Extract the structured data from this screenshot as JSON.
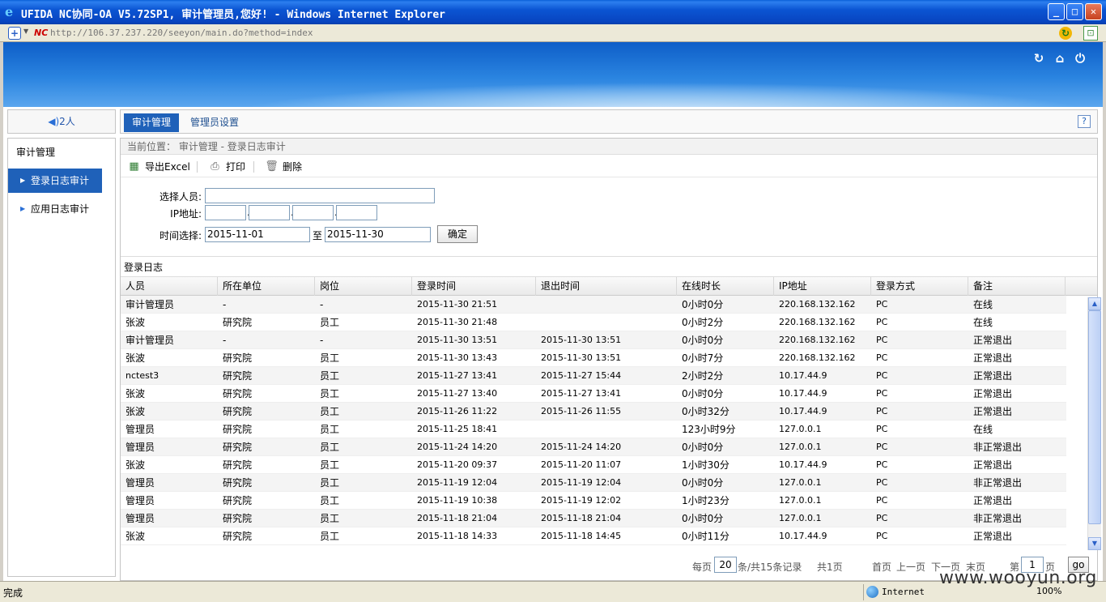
{
  "window": {
    "title": "UFIDA NC协同-OA V5.72SP1, 审计管理员,您好! - Windows Internet Explorer",
    "url": "http://106.37.237.220/seeyon/main.do?method=index",
    "nc_logo": "NC"
  },
  "header": {
    "icons": [
      "refresh-icon",
      "home-icon",
      "logout-icon"
    ]
  },
  "online": {
    "label": "2人"
  },
  "tabs": [
    {
      "label": "审计管理",
      "active": true
    },
    {
      "label": "管理员设置",
      "active": false
    }
  ],
  "help_label": "?",
  "sidebar": {
    "title": "审计管理",
    "items": [
      {
        "label": "登录日志审计",
        "active": true
      },
      {
        "label": "应用日志审计",
        "active": false
      }
    ]
  },
  "breadcrumb": "当前位置： 审计管理 - 登录日志审计",
  "toolbar": {
    "export_label": "导出Excel",
    "print_label": "打印",
    "delete_label": "删除"
  },
  "filters": {
    "person_label": "选择人员:",
    "person_value": "",
    "ip_label": "IP地址:",
    "ip_parts": [
      "",
      "",
      "",
      ""
    ],
    "time_label": "时间选择:",
    "time_from": "2015-11-01",
    "time_to_label": "至",
    "time_to": "2015-11-30",
    "confirm_label": "确定"
  },
  "section_title": "登录日志",
  "table": {
    "columns": [
      "人员",
      "所在单位",
      "岗位",
      "登录时间",
      "退出时间",
      "在线时长",
      "IP地址",
      "登录方式",
      "备注"
    ],
    "rows": [
      [
        "审计管理员",
        "-",
        "-",
        "2015-11-30 21:51",
        "",
        "0小时0分",
        "220.168.132.162",
        "PC",
        "在线"
      ],
      [
        "张波",
        "研究院",
        "员工",
        "2015-11-30 21:48",
        "",
        "0小时2分",
        "220.168.132.162",
        "PC",
        "在线"
      ],
      [
        "审计管理员",
        "-",
        "-",
        "2015-11-30 13:51",
        "2015-11-30 13:51",
        "0小时0分",
        "220.168.132.162",
        "PC",
        "正常退出"
      ],
      [
        "张波",
        "研究院",
        "员工",
        "2015-11-30 13:43",
        "2015-11-30 13:51",
        "0小时7分",
        "220.168.132.162",
        "PC",
        "正常退出"
      ],
      [
        "nctest3",
        "研究院",
        "员工",
        "2015-11-27 13:41",
        "2015-11-27 15:44",
        "2小时2分",
        "10.17.44.9",
        "PC",
        "正常退出"
      ],
      [
        "张波",
        "研究院",
        "员工",
        "2015-11-27 13:40",
        "2015-11-27 13:41",
        "0小时0分",
        "10.17.44.9",
        "PC",
        "正常退出"
      ],
      [
        "张波",
        "研究院",
        "员工",
        "2015-11-26 11:22",
        "2015-11-26 11:55",
        "0小时32分",
        "10.17.44.9",
        "PC",
        "正常退出"
      ],
      [
        "管理员",
        "研究院",
        "员工",
        "2015-11-25 18:41",
        "",
        "123小时9分",
        "127.0.0.1",
        "PC",
        "在线"
      ],
      [
        "管理员",
        "研究院",
        "员工",
        "2015-11-24 14:20",
        "2015-11-24 14:20",
        "0小时0分",
        "127.0.0.1",
        "PC",
        "非正常退出"
      ],
      [
        "张波",
        "研究院",
        "员工",
        "2015-11-20 09:37",
        "2015-11-20 11:07",
        "1小时30分",
        "10.17.44.9",
        "PC",
        "正常退出"
      ],
      [
        "管理员",
        "研究院",
        "员工",
        "2015-11-19 12:04",
        "2015-11-19 12:04",
        "0小时0分",
        "127.0.0.1",
        "PC",
        "非正常退出"
      ],
      [
        "管理员",
        "研究院",
        "员工",
        "2015-11-19 10:38",
        "2015-11-19 12:02",
        "1小时23分",
        "127.0.0.1",
        "PC",
        "正常退出"
      ],
      [
        "管理员",
        "研究院",
        "员工",
        "2015-11-18 21:04",
        "2015-11-18 21:04",
        "0小时0分",
        "127.0.0.1",
        "PC",
        "非正常退出"
      ],
      [
        "张波",
        "研究院",
        "员工",
        "2015-11-18 14:33",
        "2015-11-18 14:45",
        "0小时11分",
        "10.17.44.9",
        "PC",
        "正常退出"
      ]
    ]
  },
  "pager": {
    "per_page_label": "每页",
    "per_page_value": "20",
    "summary": "条/共15条记录",
    "pages": "共1页",
    "first": "首页",
    "prev": "上一页",
    "next": "下一页",
    "last": "末页",
    "page_label": "第",
    "page_value": "1",
    "page_suffix": "页",
    "go": "go"
  },
  "statusbar": {
    "status": "完成",
    "zone": "Internet",
    "zoom": "100%"
  },
  "watermark": "www.wooyun.org"
}
